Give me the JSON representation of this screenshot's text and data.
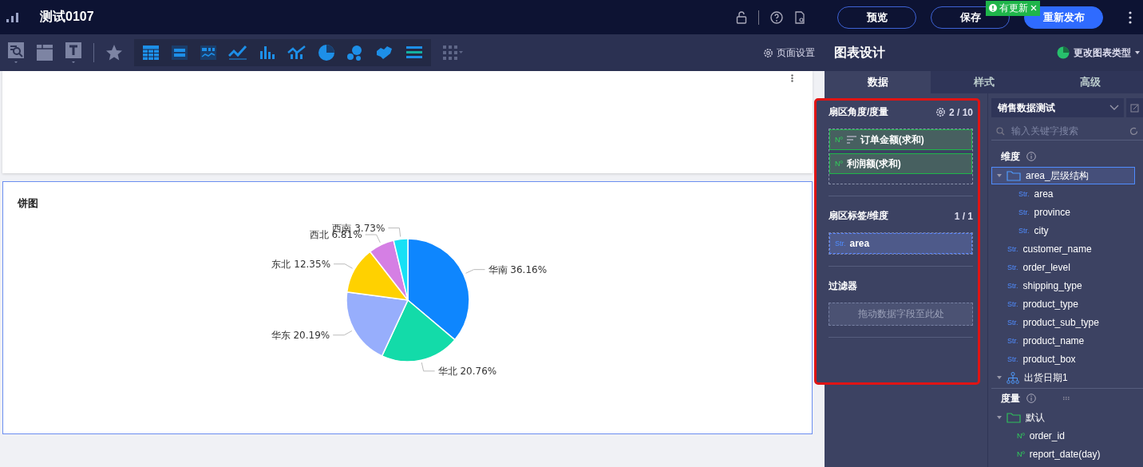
{
  "top_bar": {
    "title": "测试0107",
    "buttons": [
      {
        "label": "预览",
        "kind": "outline"
      },
      {
        "label": "保存",
        "kind": "outline"
      },
      {
        "label": "重新发布",
        "kind": "primary"
      }
    ],
    "update_badge": "有更新"
  },
  "toolbar": {
    "page_settings": "页面设置"
  },
  "pie_card": {
    "title": "饼图",
    "chart_data": {
      "type": "pie",
      "categories": [
        "华南",
        "华北",
        "华东",
        "东北",
        "西北",
        "西南"
      ],
      "colors": [
        "#0e86fe",
        "#13dba9",
        "#97aefc",
        "#ffd100",
        "#d57fe4",
        "#17e0f5"
      ],
      "series": [
        {
          "values": [
            36.16,
            20.76,
            20.19,
            12.35,
            6.81,
            3.73
          ]
        }
      ],
      "value_labels": [
        "36.16%",
        "20.76%",
        "20.19%",
        "12.35%",
        "6.81%",
        "3.73%"
      ]
    }
  },
  "panel": {
    "title": "图表设计",
    "change_type": "更改图表类型",
    "tabs": [
      {
        "label": "数据",
        "selected": true
      },
      {
        "label": "样式",
        "selected": false
      },
      {
        "label": "高级",
        "selected": false
      }
    ],
    "sections": [
      {
        "title": "扇区角度/度量",
        "count": "2 / 10",
        "settings": true,
        "items": [
          {
            "type_label": "Nº",
            "name": "订单金额(求和)",
            "sorted": true,
            "kind": "measure"
          },
          {
            "type_label": "Nº",
            "name": "利润额(求和)",
            "sorted": false,
            "kind": "measure"
          }
        ]
      },
      {
        "title": "扇区标签/维度",
        "count": "1 / 1",
        "items": [
          {
            "type_label": "Str.",
            "name": "area",
            "sorted": false,
            "kind": "dimension"
          }
        ]
      },
      {
        "title": "过滤器",
        "placeholder": "拖动数据字段至此处"
      }
    ],
    "dataset": "销售数据测试",
    "search": {
      "placeholder": "输入关键字搜索"
    },
    "dimensions": {
      "title": "维度",
      "items": [
        {
          "kind": "folder",
          "name": "area_层级结构",
          "selected": true,
          "children": [
            {
              "kind": "field",
              "type_label": "Str.",
              "name": "area",
              "selected": false
            },
            {
              "kind": "field",
              "type_label": "Str.",
              "name": "province",
              "selected": false
            },
            {
              "kind": "field",
              "type_label": "Str.",
              "name": "city",
              "selected": false
            }
          ]
        },
        {
          "kind": "field",
          "type_label": "Str.",
          "name": "customer_name",
          "selected": false
        },
        {
          "kind": "field",
          "type_label": "Str.",
          "name": "order_level",
          "selected": false
        },
        {
          "kind": "field",
          "type_label": "Str.",
          "name": "shipping_type",
          "selected": false
        },
        {
          "kind": "field",
          "type_label": "Str.",
          "name": "product_type",
          "selected": false
        },
        {
          "kind": "field",
          "type_label": "Str.",
          "name": "product_sub_type",
          "selected": false
        },
        {
          "kind": "field",
          "type_label": "Str.",
          "name": "product_name",
          "selected": false
        },
        {
          "kind": "field",
          "type_label": "Str.",
          "name": "product_box",
          "selected": false
        },
        {
          "kind": "hierarchy",
          "name": "出货日期1",
          "selected": false
        }
      ]
    },
    "measures": {
      "title": "度量",
      "items": [
        {
          "kind": "folder",
          "name": "默认",
          "selected": false,
          "children": [
            {
              "kind": "field",
              "type_label": "Nº",
              "name": "order_id",
              "selected": false
            },
            {
              "kind": "field",
              "type_label": "Nº",
              "name": "report_date(day)",
              "selected": false
            }
          ]
        }
      ]
    }
  }
}
